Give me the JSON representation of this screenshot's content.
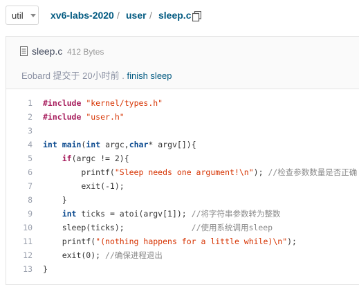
{
  "branch": {
    "label": "util"
  },
  "breadcrumb": {
    "repo": "xv6-labs-2020",
    "sep1": "/",
    "folder": "user",
    "sep2": "/",
    "file": "sleep.c"
  },
  "file_header": {
    "name": "sleep.c",
    "size": "412 Bytes",
    "commit_author": "Eobard",
    "commit_text": "提交于 20小时前 .",
    "commit_message": "finish sleep"
  },
  "code": {
    "line_numbers": [
      "1",
      "2",
      "3",
      "4",
      "5",
      "6",
      "7",
      "8",
      "9",
      "10",
      "11",
      "12",
      "13"
    ],
    "lines": [
      "#include \"kernel/types.h\"",
      "#include \"user.h\"",
      "",
      "int main(int argc,char* argv[]){",
      "    if(argc != 2){",
      "        printf(\"Sleep needs one argument!\\n\"); //检查参数数量是否正确",
      "        exit(-1);",
      "    }",
      "    int ticks = atoi(argv[1]); //将字符串参数转为整数",
      "    sleep(ticks);              //使用系统调用sleep",
      "    printf(\"(nothing happens for a little while)\\n\");",
      "    exit(0); //确保进程退出",
      "}"
    ]
  },
  "colors": {
    "link": "#005980",
    "keyword": "#a71d5d",
    "string": "#d63200",
    "comment": "#8a8a8a"
  },
  "icons": {
    "copy": "copy-icon",
    "file": "file-icon",
    "dropdown": "chevron-down-icon"
  }
}
